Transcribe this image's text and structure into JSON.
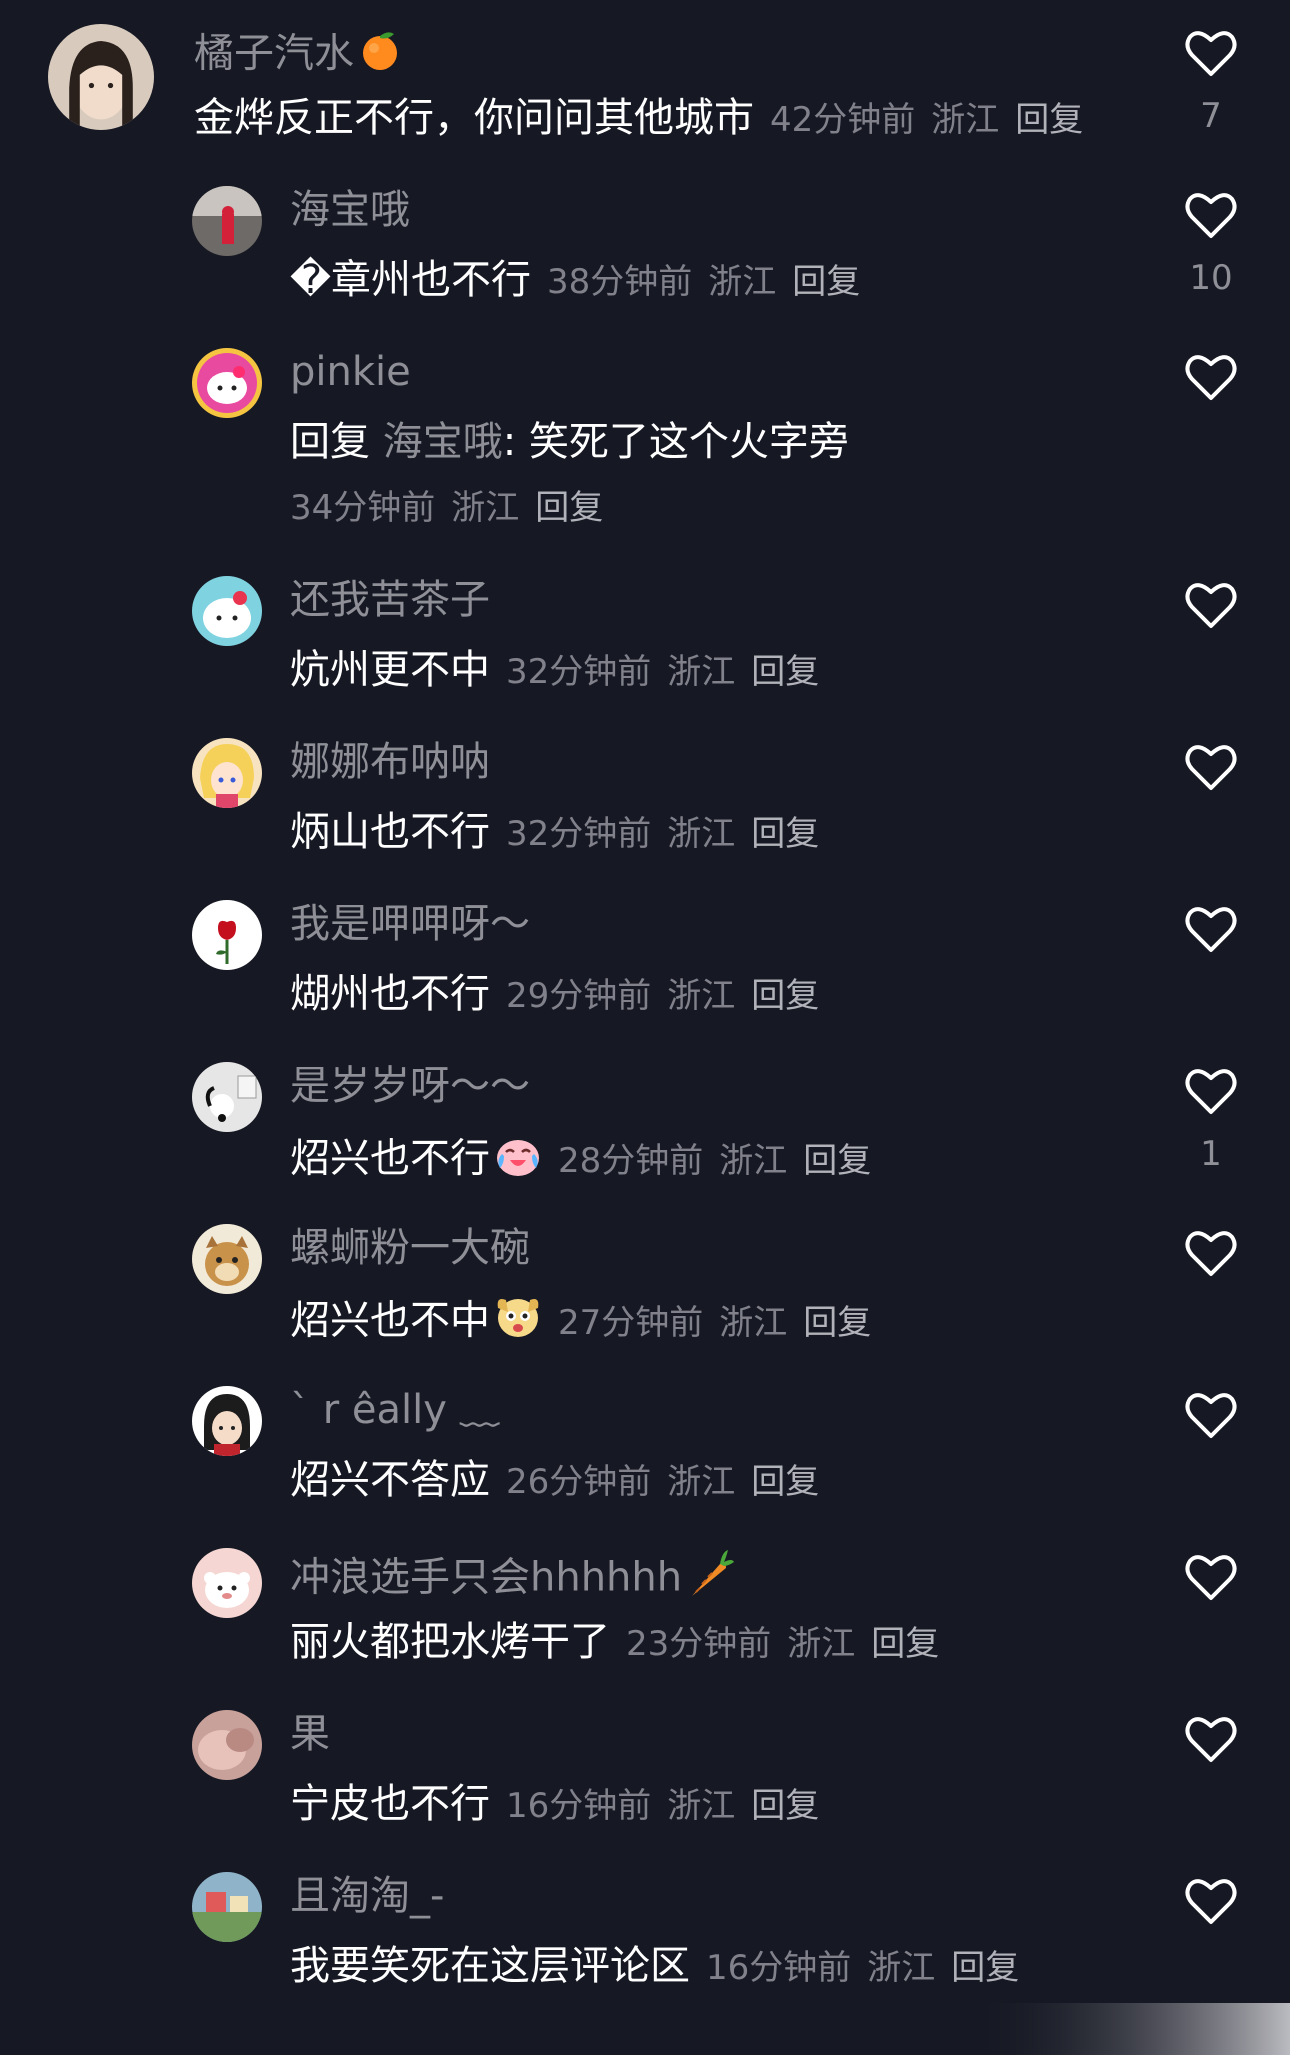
{
  "comments": [
    {
      "username": "橘子汽水",
      "username_emoji": "orange",
      "text": "金烨反正不行，你问问其他城市",
      "time": "42分钟前",
      "location": "浙江",
      "reply_label": "回复",
      "likes": "7"
    },
    {
      "username": "海宝哦",
      "text": "�章州也不行",
      "time": "38分钟前",
      "location": "浙江",
      "reply_label": "回复",
      "likes": "10"
    },
    {
      "username": "pinkie",
      "reply_prefix": "回复",
      "reply_target": "海宝哦",
      "text": ": 笑死了这个火字旁",
      "time": "34分钟前",
      "location": "浙江",
      "reply_label": "回复",
      "likes": ""
    },
    {
      "username": "还我苦茶子",
      "text": "炕州更不中",
      "time": "32分钟前",
      "location": "浙江",
      "reply_label": "回复",
      "likes": ""
    },
    {
      "username": "娜娜布呐呐",
      "text": "炳山也不行",
      "time": "32分钟前",
      "location": "浙江",
      "reply_label": "回复",
      "likes": ""
    },
    {
      "username": "我是呷呷呀～",
      "text": "煳州也不行",
      "time": "29分钟前",
      "location": "浙江",
      "reply_label": "回复",
      "likes": ""
    },
    {
      "username": "是岁岁呀～～",
      "text": "炤兴也不行",
      "text_emoji": "crying-laughing",
      "time": "28分钟前",
      "location": "浙江",
      "reply_label": "回复",
      "likes": "1"
    },
    {
      "username": "螺蛳粉一大碗",
      "text": "炤兴也不中",
      "text_emoji": "dog-face",
      "time": "27分钟前",
      "location": "浙江",
      "reply_label": "回复",
      "likes": ""
    },
    {
      "username": "` r êally ﹏",
      "text": "炤兴不答应",
      "time": "26分钟前",
      "location": "浙江",
      "reply_label": "回复",
      "likes": ""
    },
    {
      "username": "冲浪选手只会hhhhhh",
      "username_emoji": "carrot",
      "text": "丽火都把水烤干了",
      "time": "23分钟前",
      "location": "浙江",
      "reply_label": "回复",
      "likes": ""
    },
    {
      "username": "果",
      "text": "宁皮也不行",
      "time": "16分钟前",
      "location": "浙江",
      "reply_label": "回复",
      "likes": ""
    },
    {
      "username": "且淘淘_-",
      "text": "我要笑死在这层评论区",
      "time": "16分钟前",
      "location": "浙江",
      "reply_label": "回复",
      "likes": ""
    }
  ],
  "colors": {
    "background": "#161823",
    "username": "#8e8f97",
    "text": "#ffffff",
    "meta": "#80818a",
    "heart_outline": "#ffffff"
  }
}
